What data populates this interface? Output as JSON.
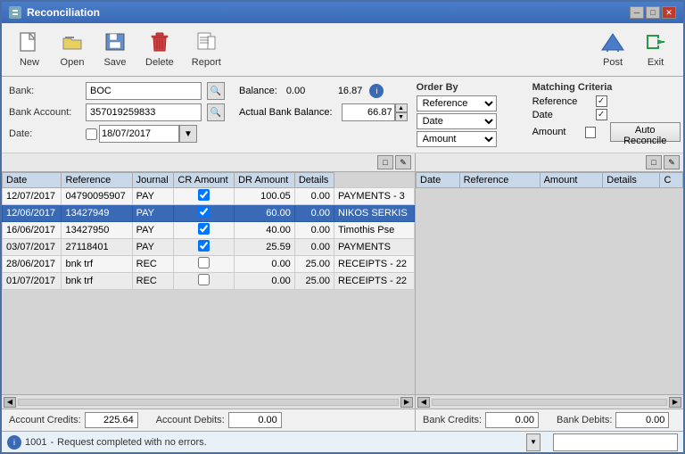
{
  "window": {
    "title": "Reconciliation"
  },
  "toolbar": {
    "new_label": "New",
    "open_label": "Open",
    "save_label": "Save",
    "delete_label": "Delete",
    "report_label": "Report",
    "post_label": "Post",
    "exit_label": "Exit"
  },
  "form": {
    "bank_label": "Bank:",
    "bank_value": "BOC",
    "bank_account_label": "Bank Account:",
    "bank_account_value": "357019259833",
    "balance_label": "Balance:",
    "balance_value": "0.00",
    "balance_value2": "16.87",
    "date_label": "Date:",
    "date_value": "18/07/2017",
    "actual_bank_balance_label": "Actual Bank Balance:",
    "actual_bank_balance_value": "66.87"
  },
  "order_by": {
    "title": "Order By",
    "options": [
      "Reference",
      "Date",
      "Amount"
    ],
    "selected": [
      "Reference",
      "Date",
      "Amount"
    ]
  },
  "matching_criteria": {
    "title": "Matching Criteria",
    "reference_label": "Reference",
    "reference_checked": true,
    "date_label": "Date",
    "date_checked": true,
    "amount_label": "Amount",
    "amount_checked": false,
    "auto_reconcile_label": "Auto Reconcile"
  },
  "left_table": {
    "columns": [
      "Date",
      "Reference",
      "Journal",
      "CR Amount",
      "DR Amount",
      "Details"
    ],
    "rows": [
      {
        "date": "12/07/2017",
        "reference": "04790095907",
        "journal": "PAY",
        "checked": true,
        "cr_amount": "100.05",
        "dr_amount": "0.00",
        "details": "PAYMENTS - 3",
        "selected": false
      },
      {
        "date": "12/06/2017",
        "reference": "13427949",
        "journal": "PAY",
        "checked": true,
        "cr_amount": "60.00",
        "dr_amount": "0.00",
        "details": "NIKOS SERKIS",
        "selected": true
      },
      {
        "date": "16/06/2017",
        "reference": "13427950",
        "journal": "PAY",
        "checked": true,
        "cr_amount": "40.00",
        "dr_amount": "0.00",
        "details": "Timothis Pse",
        "selected": false
      },
      {
        "date": "03/07/2017",
        "reference": "27118401",
        "journal": "PAY",
        "checked": true,
        "cr_amount": "25.59",
        "dr_amount": "0.00",
        "details": "PAYMENTS",
        "selected": false
      },
      {
        "date": "28/06/2017",
        "reference": "bnk trf",
        "journal": "REC",
        "checked": false,
        "cr_amount": "0.00",
        "dr_amount": "25.00",
        "details": "RECEIPTS - 22",
        "selected": false
      },
      {
        "date": "01/07/2017",
        "reference": "bnk trf",
        "journal": "REC",
        "checked": false,
        "cr_amount": "0.00",
        "dr_amount": "25.00",
        "details": "RECEIPTS - 22",
        "selected": false
      }
    ]
  },
  "right_table": {
    "columns": [
      "Date",
      "Reference",
      "Amount",
      "Details",
      "C"
    ],
    "rows": []
  },
  "footer": {
    "account_credits_label": "Account Credits:",
    "account_credits_value": "225.64",
    "account_debits_label": "Account Debits:",
    "account_debits_value": "0.00",
    "bank_credits_label": "Bank Credits:",
    "bank_credits_value": "0.00",
    "bank_debits_label": "Bank Debits:",
    "bank_debits_value": "0.00"
  },
  "status": {
    "code": "1001",
    "message": "Request completed with no errors."
  }
}
